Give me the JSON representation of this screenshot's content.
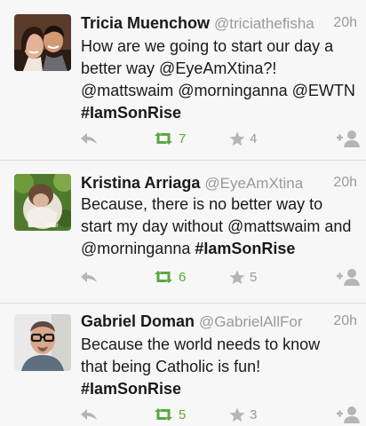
{
  "colors": {
    "background": "#f7f7f7",
    "retweet_green": "#5aa83f",
    "icon_gray": "#b5b5b5",
    "meta_gray": "#9a9a9a"
  },
  "tweets": [
    {
      "name": "Tricia Muenchow",
      "handle": "@triciathefisha",
      "time": "20h",
      "lines": [
        "How are we going to start our day a",
        "better way @EyeAmXtina?!",
        "@mattswaim @morninganna @EWTN"
      ],
      "hashtag": "#IamSonRise",
      "retweets": "7",
      "favorites": "4"
    },
    {
      "name": "Kristina Arriaga",
      "handle": "@EyeAmXtina",
      "time": "20h",
      "lines": [
        "Because, there is no better way to",
        "start my day without @mattswaim and",
        "@morninganna "
      ],
      "hashtag": "#IamSonRise",
      "retweets": "6",
      "favorites": "5"
    },
    {
      "name": "Gabriel Doman",
      "handle": "@GabrielAllFor",
      "time": "20h",
      "lines": [
        "Because the world needs to know",
        "that being Catholic is fun!"
      ],
      "hashtag": "#IamSonRise",
      "retweets": "5",
      "favorites": "3"
    }
  ]
}
